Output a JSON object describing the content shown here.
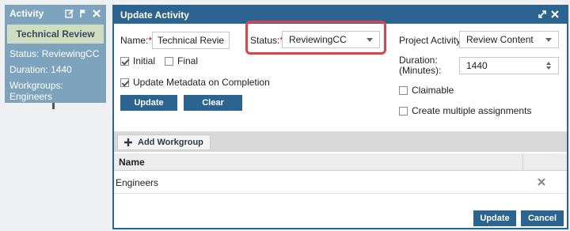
{
  "activity_card": {
    "title": "Activity",
    "name": "Technical Review",
    "status": "Status: ReviewingCC",
    "duration": "Duration: 1440",
    "workgroups": "Workgroups: Engineers"
  },
  "dialog": {
    "title": "Update Activity",
    "name_label": "Name:",
    "name_value": "Technical Review",
    "status_label": "Status:",
    "status_value": "ReviewingCC",
    "initial_label": "Initial",
    "initial_checked": true,
    "final_label": "Final",
    "final_checked": false,
    "update_metadata_label": "Update Metadata on Completion",
    "update_metadata_checked": true,
    "update_button": "Update",
    "clear_button": "Clear",
    "project_activity_label": "Project Activity:",
    "project_activity_value": "Review Content",
    "duration_label_1": "Duration:",
    "duration_label_2": "(Minutes):",
    "duration_value": "1440",
    "claimable_label": "Claimable",
    "claimable_checked": false,
    "multiple_label": "Create multiple assignments",
    "multiple_checked": false,
    "add_workgroup": "Add Workgroup",
    "grid_header_name": "Name",
    "grid_rows": [
      {
        "name": "Engineers"
      }
    ],
    "footer_update": "Update",
    "footer_cancel": "Cancel"
  },
  "colors": {
    "brand_blue": "#2b6490",
    "card_blue": "#7ea3bd",
    "highlight_red": "#e0424a"
  }
}
